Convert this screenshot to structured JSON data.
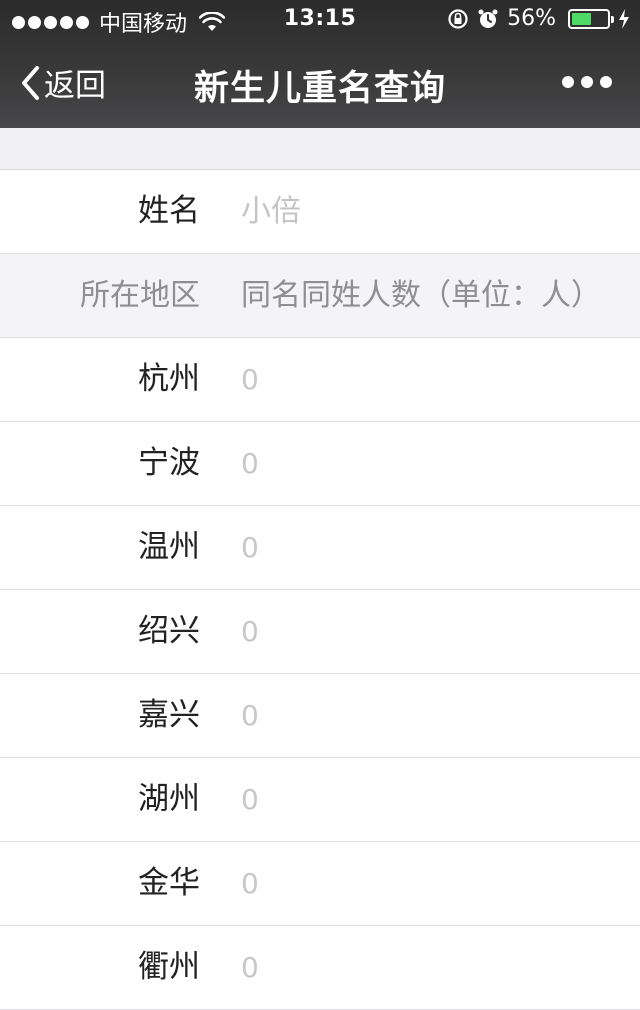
{
  "status_bar": {
    "carrier": "中国移动",
    "time": "13:15",
    "battery": "56%",
    "battery_level": 56,
    "icons": [
      "signal-dots-icon",
      "wifi-icon",
      "rotation-lock-icon",
      "alarm-icon",
      "battery-icon",
      "charging-bolt-icon"
    ]
  },
  "nav": {
    "back_label": "返回",
    "title": "新生儿重名查询"
  },
  "form": {
    "name_label": "姓名",
    "name_placeholder": "小倍"
  },
  "table": {
    "header_region": "所在地区",
    "header_count": "同名同姓人数（单位：人）",
    "rows": [
      {
        "region": "杭州",
        "count": "0"
      },
      {
        "region": "宁波",
        "count": "0"
      },
      {
        "region": "温州",
        "count": "0"
      },
      {
        "region": "绍兴",
        "count": "0"
      },
      {
        "region": "嘉兴",
        "count": "0"
      },
      {
        "region": "湖州",
        "count": "0"
      },
      {
        "region": "金华",
        "count": "0"
      },
      {
        "region": "衢州",
        "count": "0"
      }
    ]
  },
  "colors": {
    "nav_background": "#3a3a3b",
    "battery_fill": "#4cd964",
    "page_background": "#efeff4"
  }
}
